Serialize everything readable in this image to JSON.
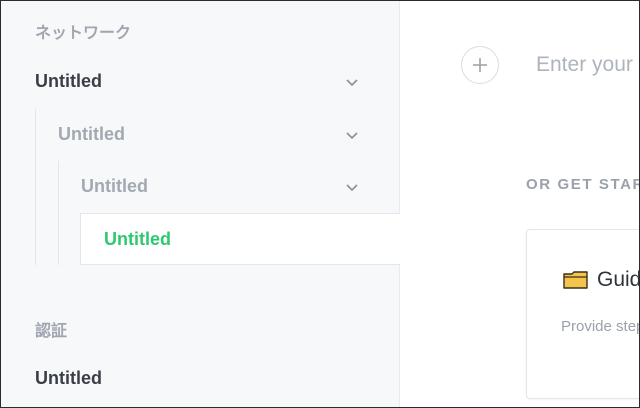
{
  "sidebar": {
    "sections": [
      {
        "title": "ネットワーク"
      },
      {
        "title": "認証"
      }
    ],
    "tree": [
      {
        "label": "Untitled"
      },
      {
        "label": "Untitled"
      },
      {
        "label": "Untitled"
      },
      {
        "label": "Untitled"
      }
    ],
    "auth_items": [
      {
        "label": "Untitled"
      }
    ],
    "active_color": "#2ec96f"
  },
  "main": {
    "title_placeholder": "Enter your title",
    "get_started_label": "OR GET STARTED",
    "cards": [
      {
        "icon": "folder-icon",
        "title": "Guide",
        "description": "Provide step-by-step instructions"
      }
    ]
  }
}
